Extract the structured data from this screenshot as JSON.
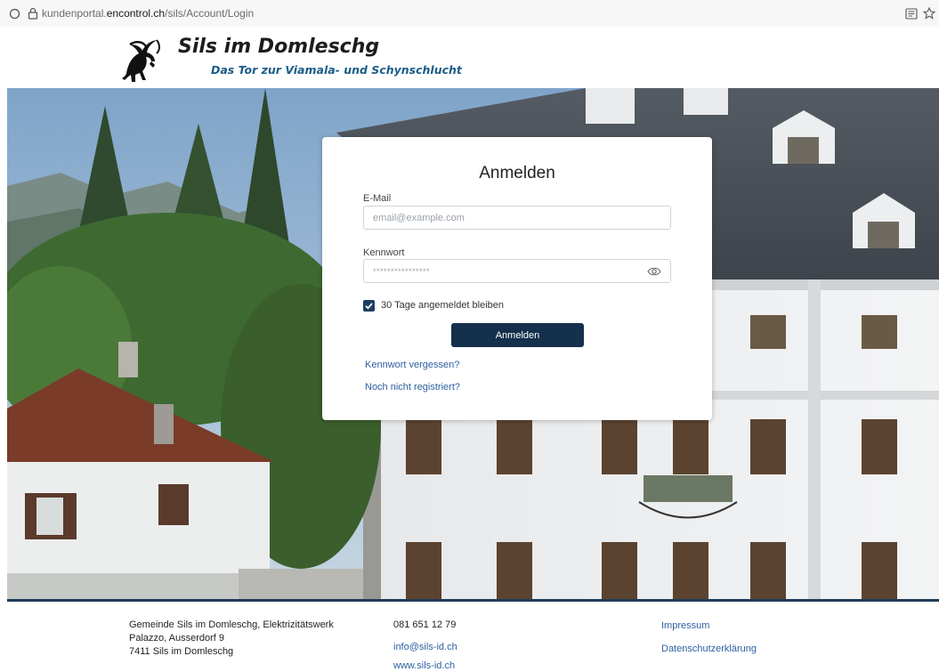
{
  "browser": {
    "url_prefix": "kundenportal.",
    "url_domain": "encontrol.ch",
    "url_path": "/sils/Account/Login",
    "icons": [
      "circle-icon",
      "lock-icon",
      "reader-view-icon",
      "bookmark-star-icon"
    ]
  },
  "header": {
    "title": "Sils im Domleschg",
    "subtitle": "Das Tor zur Viamala- und Schynschlucht"
  },
  "login": {
    "title": "Anmelden",
    "email_label": "E-Mail",
    "email_placeholder": "email@example.com",
    "password_label": "Kennwort",
    "password_value": "****************",
    "remember_label": "30 Tage angemeldet bleiben",
    "remember_checked": true,
    "submit_label": "Anmelden",
    "forgot_link": "Kennwort vergessen?",
    "register_link": "Noch nicht registriert?"
  },
  "footer": {
    "address_line1": "Gemeinde Sils im Domleschg, Elektrizitätswerk",
    "address_line2": "Palazzo, Ausserdorf 9",
    "address_line3": "7411 Sils im Domleschg",
    "phone": "081 651 12 79",
    "email": "info@sils-id.ch",
    "website": "www.sils-id.ch",
    "impressum": "Impressum",
    "privacy": "Datenschutzerklärung"
  },
  "colors": {
    "primary_button": "#14304d",
    "link": "#2d5fa0",
    "subtitle": "#1a5d88"
  }
}
